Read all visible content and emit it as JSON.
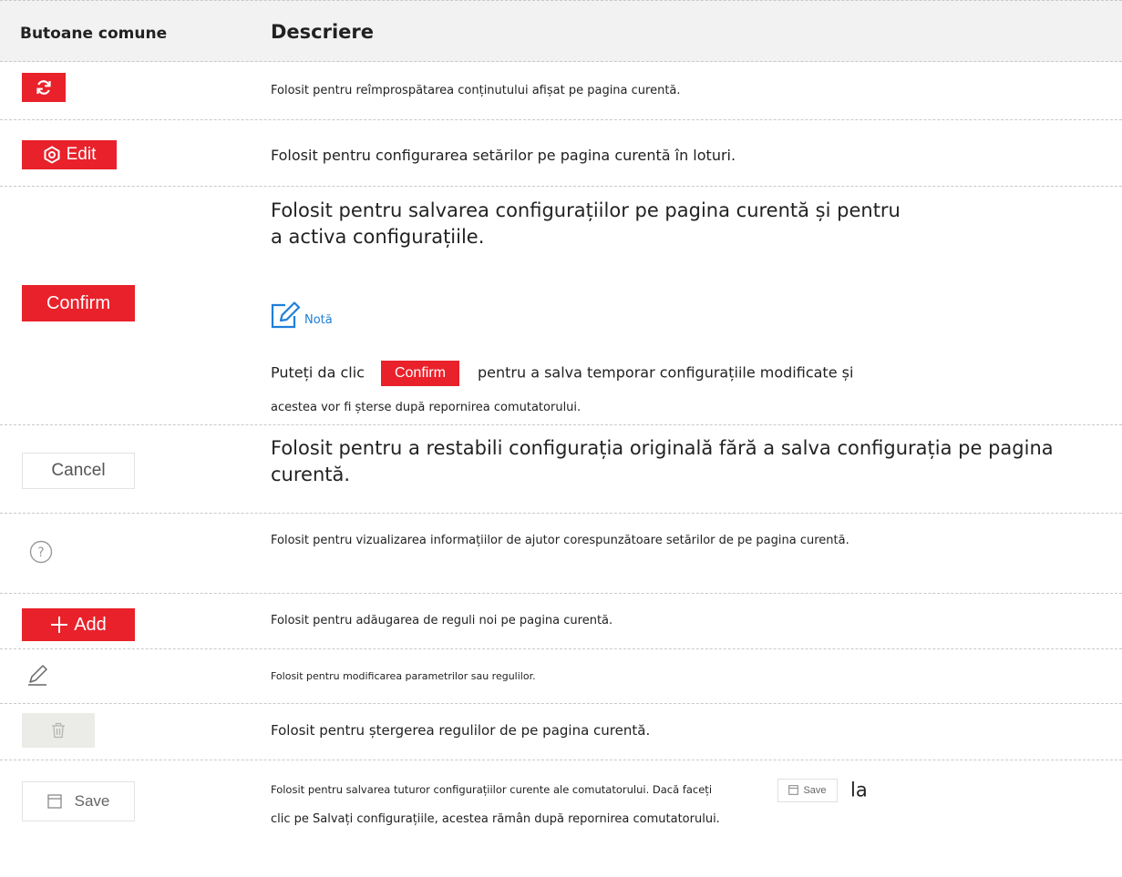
{
  "header": {
    "col1": "Butoane comune",
    "col2": "Descriere"
  },
  "rows": {
    "refresh": {
      "icon": "refresh-icon",
      "desc": "Folosit pentru reîmprospătarea conținutului afișat pe pagina curentă."
    },
    "edit": {
      "button_label": "Edit",
      "icon": "hexagon-settings-icon",
      "desc": "Folosit pentru configurarea setărilor pe pagina curentă în loturi."
    },
    "confirm": {
      "button_label": "Confirm",
      "desc_line1": "Folosit pentru salvarea configurațiilor pe pagina curentă și pentru",
      "desc_line2": "a activa configurațiile.",
      "note_label": "Notă",
      "note_icon": "note-edit-icon",
      "note_prefix": "Puteți da clic",
      "note_button": "Confirm",
      "note_suffix": "pentru a salva temporar configurațiile modificate și",
      "note_line2": "acestea vor fi șterse după repornirea comutatorului."
    },
    "cancel": {
      "button_label": "Cancel",
      "desc": "Folosit pentru a restabili configurația originală fără a salva configurația pe pagina curentă."
    },
    "help": {
      "icon": "help-circle-icon",
      "desc": "Folosit pentru vizualizarea informațiilor de ajutor corespunzătoare setărilor de pe pagina curentă."
    },
    "add": {
      "button_label": "Add",
      "icon": "plus-icon",
      "desc": "Folosit pentru adăugarea de reguli noi pe pagina curentă."
    },
    "modify": {
      "icon": "pencil-icon",
      "desc": "Folosit pentru modificarea parametrilor sau regulilor."
    },
    "delete": {
      "icon": "trash-icon",
      "desc": "Folosit pentru ștergerea regulilor de pe pagina curentă."
    },
    "save": {
      "button_label": "Save",
      "icon": "save-icon",
      "desc_part1": "Folosit pentru salvarea tuturor configurațiilor curente ale comutatorului. Dacă faceți",
      "inline_button": "Save",
      "desc_la": "la",
      "desc_line2": "clic pe Salvați configurațiile, acestea rămân după repornirea comutatorului."
    }
  },
  "colors": {
    "accent_red": "#e9212b",
    "note_blue": "#1f7fd8",
    "header_bg": "#f2f2f2"
  }
}
